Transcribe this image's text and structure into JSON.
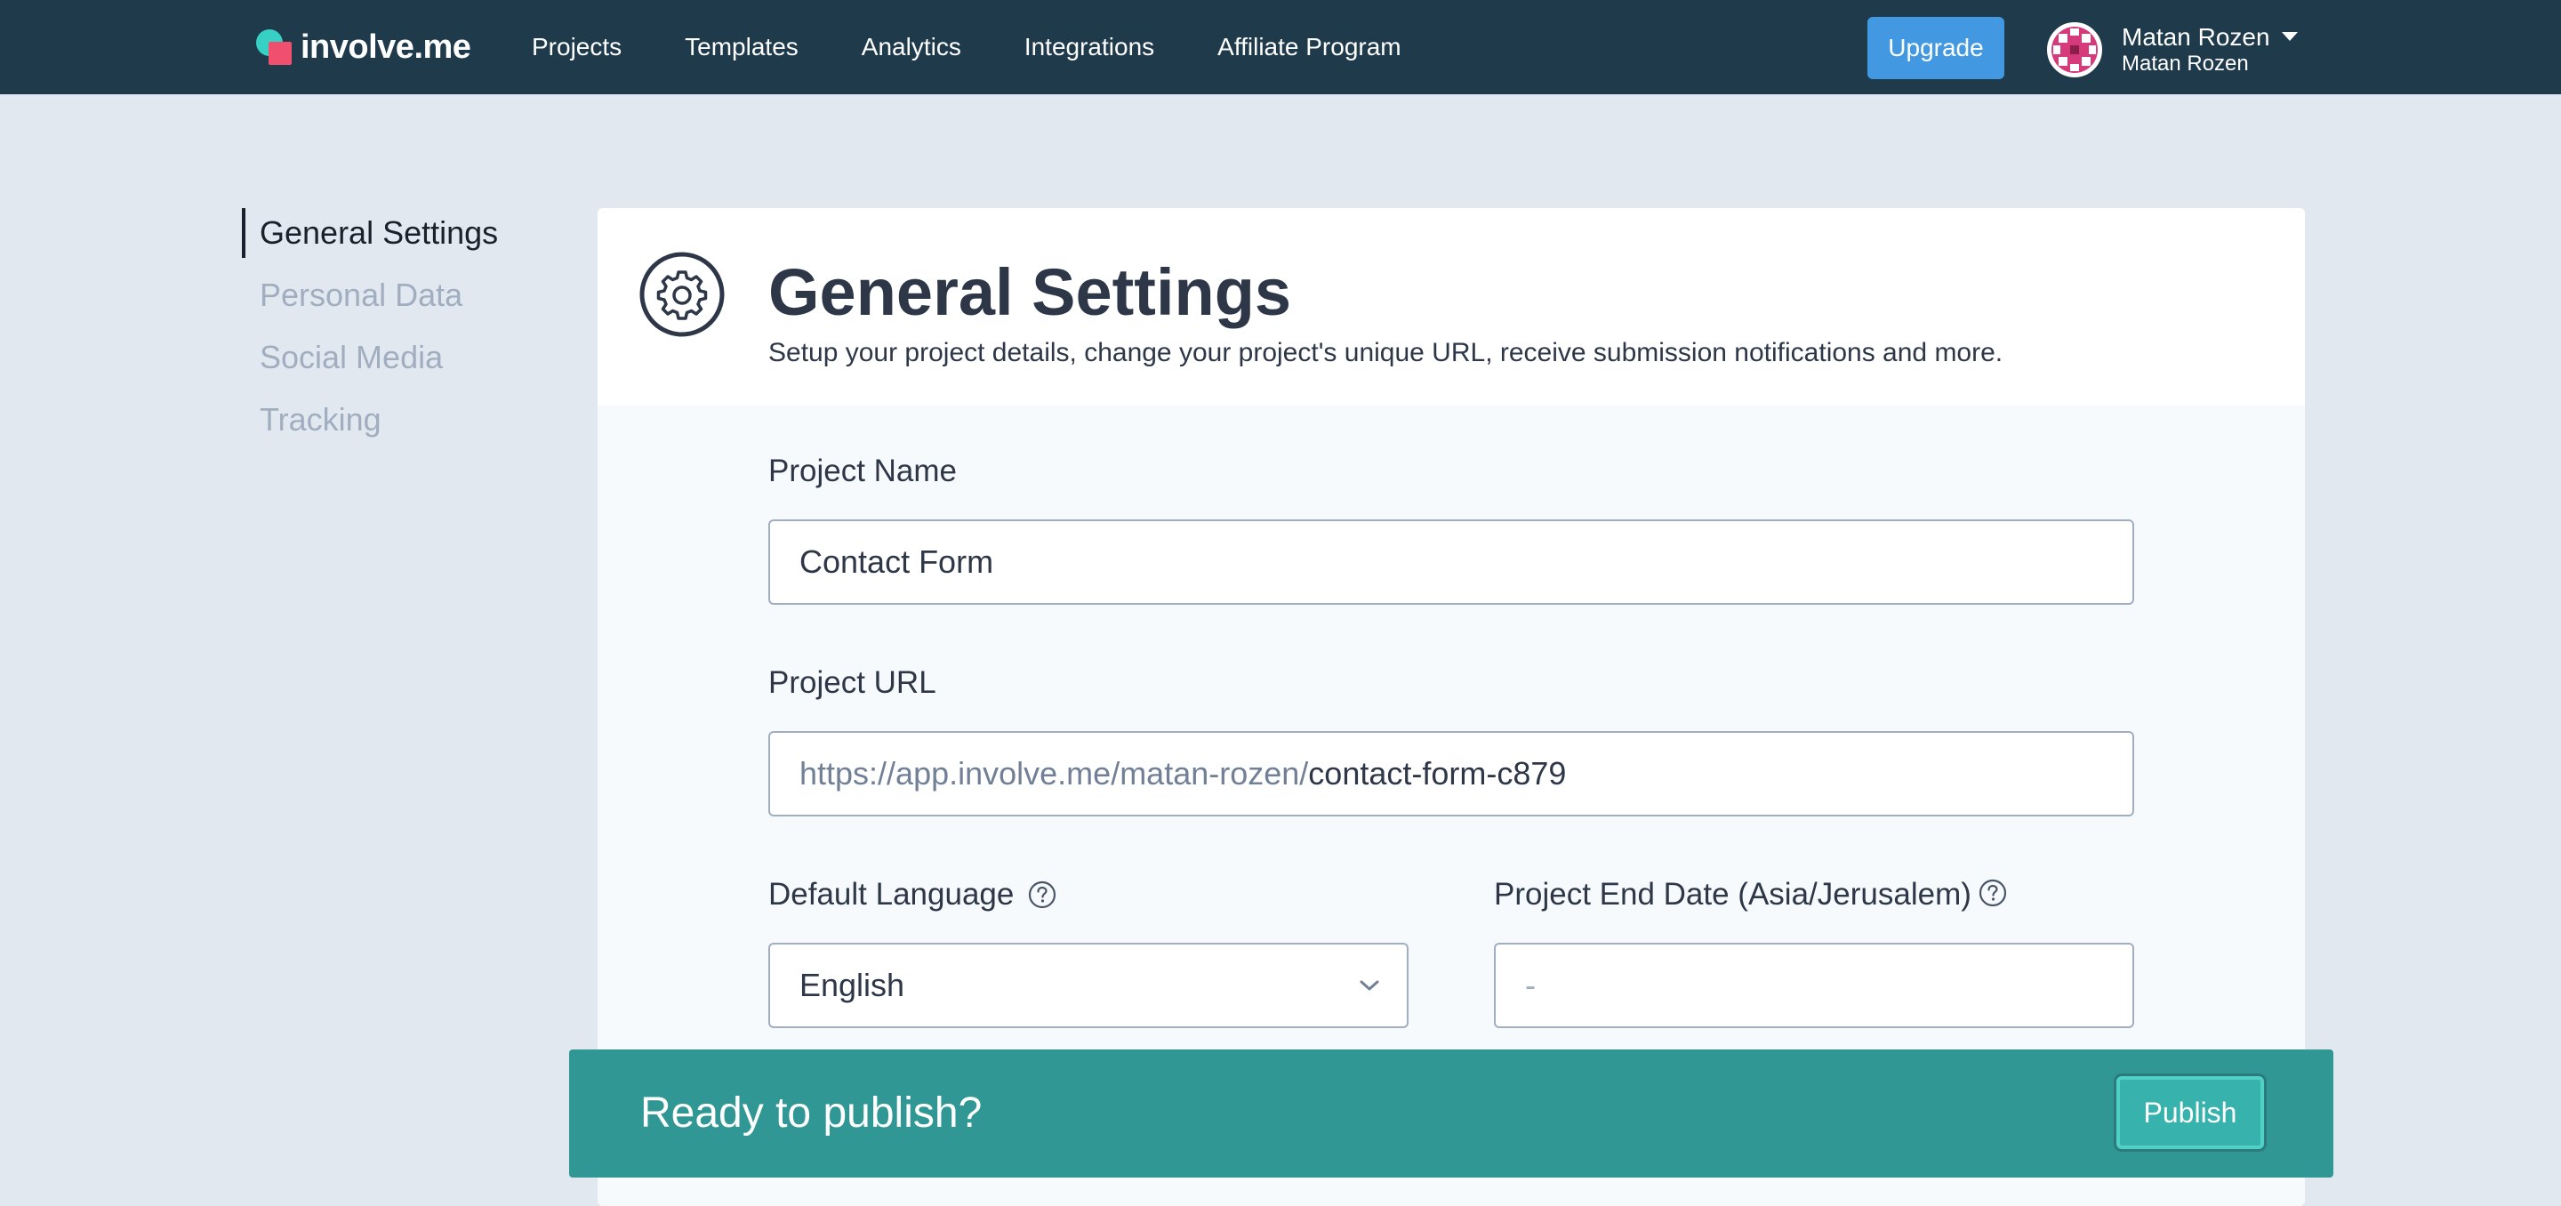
{
  "brand": {
    "name": "involve.me"
  },
  "nav": {
    "items": [
      "Projects",
      "Templates",
      "Analytics",
      "Integrations",
      "Affiliate Program"
    ]
  },
  "header": {
    "upgrade_label": "Upgrade",
    "user_name": "Matan Rozen",
    "user_sub": "Matan Rozen"
  },
  "sidebar": {
    "items": [
      {
        "label": "General Settings",
        "active": true
      },
      {
        "label": "Personal Data",
        "active": false
      },
      {
        "label": "Social Media",
        "active": false
      },
      {
        "label": "Tracking",
        "active": false
      }
    ]
  },
  "page": {
    "title": "General Settings",
    "subtitle": "Setup your project details, change your project's unique URL, receive submission notifications and more."
  },
  "form": {
    "project_name": {
      "label": "Project Name",
      "value": "Contact Form"
    },
    "project_url": {
      "label": "Project URL",
      "prefix": "https://app.involve.me/matan-rozen/",
      "value": "contact-form-c879"
    },
    "default_language": {
      "label": "Default Language",
      "value": "English"
    },
    "end_date": {
      "label": "Project End Date (Asia/Jerusalem)",
      "placeholder": "-"
    }
  },
  "publish": {
    "prompt": "Ready to publish?",
    "button_label": "Publish"
  },
  "colors": {
    "topbar": "#1e3a4b",
    "accent_blue": "#4299e1",
    "publish_bar": "#319795",
    "logo_teal": "#36d1c4",
    "logo_pink": "#f0506e"
  },
  "icons": {
    "header": "gear-icon",
    "help": "question-circle-icon",
    "select": "chevron-down-icon",
    "user_menu": "caret-down-icon"
  }
}
